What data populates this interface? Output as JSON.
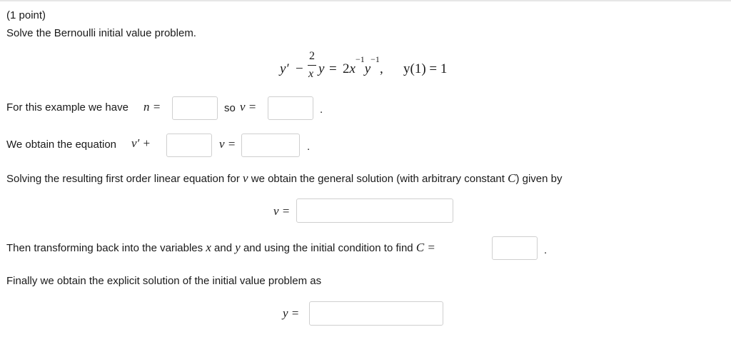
{
  "problem": {
    "points": "(1 point)",
    "instruction": "Solve the Bernoulli initial value problem."
  },
  "equation": {
    "y_prime": "y′",
    "minus": "−",
    "numerator": "2",
    "denominator": "x",
    "y": "y",
    "equals": "=",
    "rhs_coef": "2",
    "x_var": "x",
    "exp1": "−1",
    "y_var": "y",
    "exp2": "−1",
    "comma": ",",
    "initial_condition": "y(1) = 1"
  },
  "line_n": {
    "prefix": "For this example we have",
    "n_symbol": "n =",
    "so_text": "so",
    "v_symbol": "v =",
    "n_value": "",
    "v_value": "",
    "period": "."
  },
  "line_eq": {
    "prefix": "We obtain the equation",
    "v_prime_symbol": "v′ +",
    "coef_value": "",
    "v_equals": "v =",
    "rhs_value": "",
    "period": "."
  },
  "line_general": {
    "text_1": "Solving the resulting first order linear equation for",
    "v_symbol": "v",
    "text_2": "we obtain the general solution (with arbitrary constant",
    "c_symbol": "C",
    "text_3": ") given by",
    "v_equals": "v =",
    "value": ""
  },
  "line_transform": {
    "text_1": "Then transforming back into the variables",
    "x_symbol": "x",
    "and_text": "and",
    "y_symbol": "y",
    "text_2": "and using the initial condition to find",
    "c_equals": "C =",
    "value": "",
    "period": "."
  },
  "line_final": {
    "text": "Finally we obtain the explicit solution of the initial value problem as",
    "y_equals": "y =",
    "value": ""
  }
}
